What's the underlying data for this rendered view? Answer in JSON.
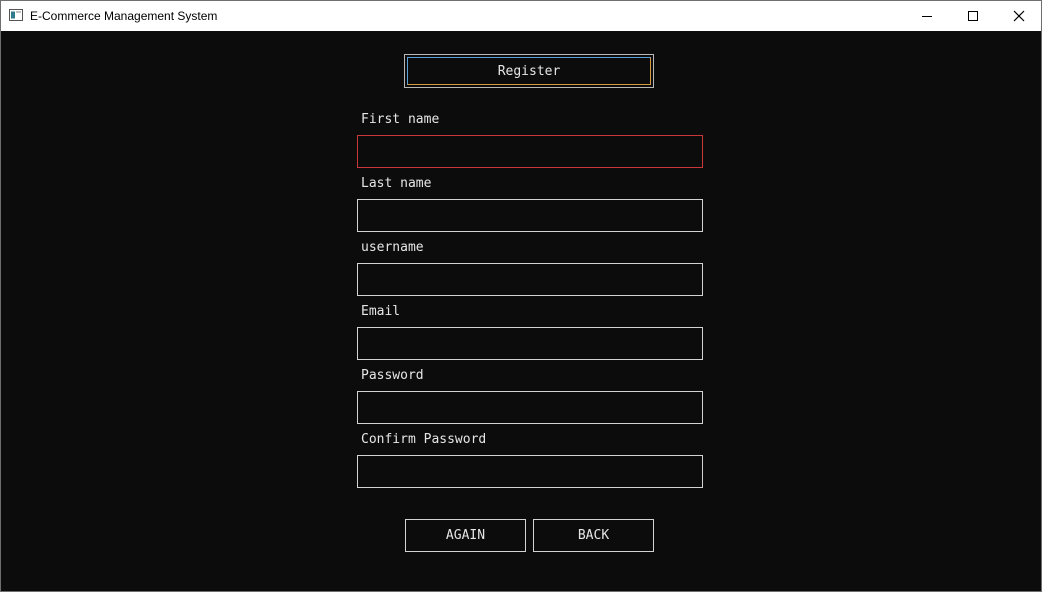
{
  "window": {
    "title": "E-Commerce Management System"
  },
  "header": {
    "register_label": "Register"
  },
  "form": {
    "fields": [
      {
        "label": "First name",
        "value": ""
      },
      {
        "label": "Last name",
        "value": ""
      },
      {
        "label": "username",
        "value": ""
      },
      {
        "label": "Email",
        "value": ""
      },
      {
        "label": "Password",
        "value": ""
      },
      {
        "label": "Confirm Password",
        "value": ""
      }
    ]
  },
  "actions": {
    "again_label": "AGAIN",
    "back_label": "BACK"
  },
  "colors": {
    "background": "#0c0c0c",
    "text": "#e6e6e6",
    "border": "#d4d4d4",
    "invalid_border": "#c8383a"
  },
  "icons": {
    "app": "app-icon",
    "minimize": "minimize-icon",
    "maximize": "maximize-icon",
    "close": "close-icon"
  }
}
